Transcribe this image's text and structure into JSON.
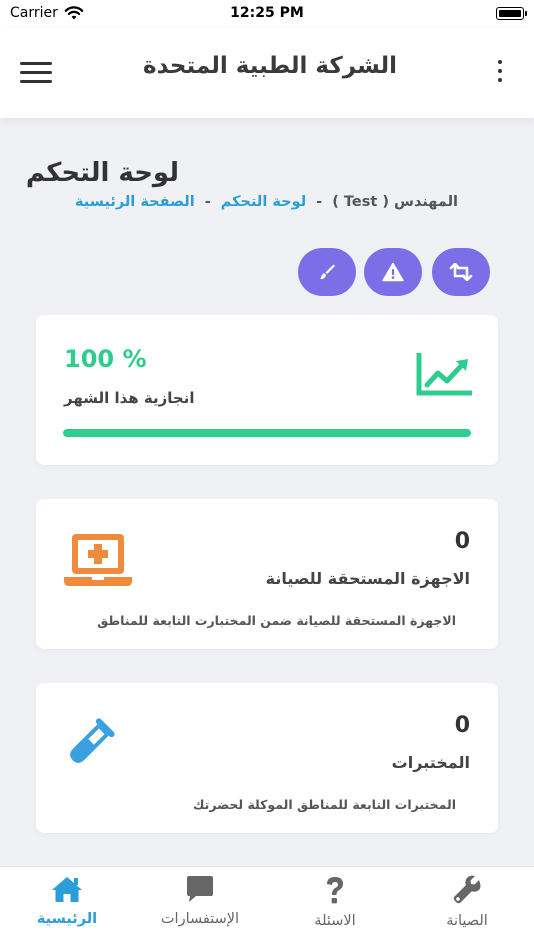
{
  "status_bar": {
    "carrier": "Carrier",
    "time": "12:25 PM"
  },
  "header": {
    "title": "الشركة الطبية المتحدة"
  },
  "page": {
    "title": "لوحة التحكم",
    "breadcrumb": {
      "engineer": "المهندس ( Test )",
      "separator": "-",
      "dashboard": "لوحة التحكم",
      "home": "الصفحة الرئيسية"
    }
  },
  "actions": [
    {
      "icon": "brush-icon"
    },
    {
      "icon": "warning-icon"
    },
    {
      "icon": "retweet-icon"
    }
  ],
  "progress_card": {
    "percent_text": "100 %",
    "percent": 100,
    "label": "انجازية هذا الشهر",
    "icon": "trend-chart-icon"
  },
  "devices_card": {
    "count": "0",
    "label": "الاجهزة المستحقة للصيانة",
    "description": "الاجهزة المستحقة للصيانة ضمن المختبارت التابعة للمناطق",
    "icon": "laptop-medical-icon"
  },
  "labs_card": {
    "count": "0",
    "label": "المختبرات",
    "description": "المختبرات التابعة للمناطق الموكلة لحضرتك",
    "icon": "test-tube-icon"
  },
  "tabs": [
    {
      "label": "الرئيسية",
      "icon": "home-icon",
      "active": true
    },
    {
      "label": "الإستفسارات",
      "icon": "chat-icon",
      "active": false
    },
    {
      "label": "الاسئلة",
      "icon": "question-icon",
      "active": false
    },
    {
      "label": "الصيانة",
      "icon": "wrench-icon",
      "active": false
    }
  ],
  "colors": {
    "accent_purple": "#7c6ee6",
    "success_green": "#2ecc8f",
    "link_blue": "#2a9ed8",
    "orange": "#f08a3c",
    "tube_blue": "#3aa0e0"
  }
}
